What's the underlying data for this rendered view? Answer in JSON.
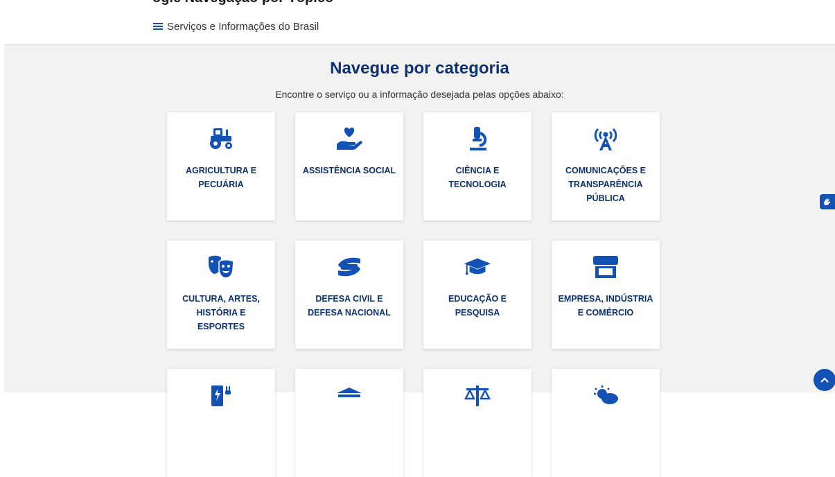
{
  "header": {
    "truncated_title": "ogle Navegação por Tópico",
    "menu_label": "Serviços e Informações do Brasil"
  },
  "section": {
    "title": "Navegue por categoria",
    "subtitle": "Encontre o serviço ou a informação desejada pelas opções abaixo:"
  },
  "categories": [
    {
      "label": "AGRICULTURA E PECUÁRIA",
      "icon": "tractor-icon"
    },
    {
      "label": "ASSISTÊNCIA SOCIAL",
      "icon": "hand-heart-icon"
    },
    {
      "label": "CIÊNCIA E TECNOLOGIA",
      "icon": "microscope-icon"
    },
    {
      "label": "COMUNICAÇÕES E TRANSPARÊNCIA PÚBLICA",
      "icon": "broadcast-tower-icon"
    },
    {
      "label": "CULTURA, ARTES, HISTÓRIA E ESPORTES",
      "icon": "theater-masks-icon"
    },
    {
      "label": "DEFESA CIVIL E DEFESA NACIONAL",
      "icon": "hands-helping-icon"
    },
    {
      "label": "EDUCAÇÃO E PESQUISA",
      "icon": "graduation-cap-icon"
    },
    {
      "label": "EMPRESA, INDÚSTRIA E COMÉRCIO",
      "icon": "store-icon"
    },
    {
      "label": "",
      "icon": "charging-station-icon"
    },
    {
      "label": "",
      "icon": "university-icon"
    },
    {
      "label": "",
      "icon": "balance-scale-icon"
    },
    {
      "label": "",
      "icon": "cloud-sun-icon"
    }
  ],
  "colors": {
    "brand_blue": "#1351b4",
    "dark_blue": "#0c326f",
    "background": "#f2f2f2"
  },
  "widgets": {
    "vlibras_icon": "sign-language-icon",
    "back_to_top_icon": "chevron-up-icon"
  }
}
